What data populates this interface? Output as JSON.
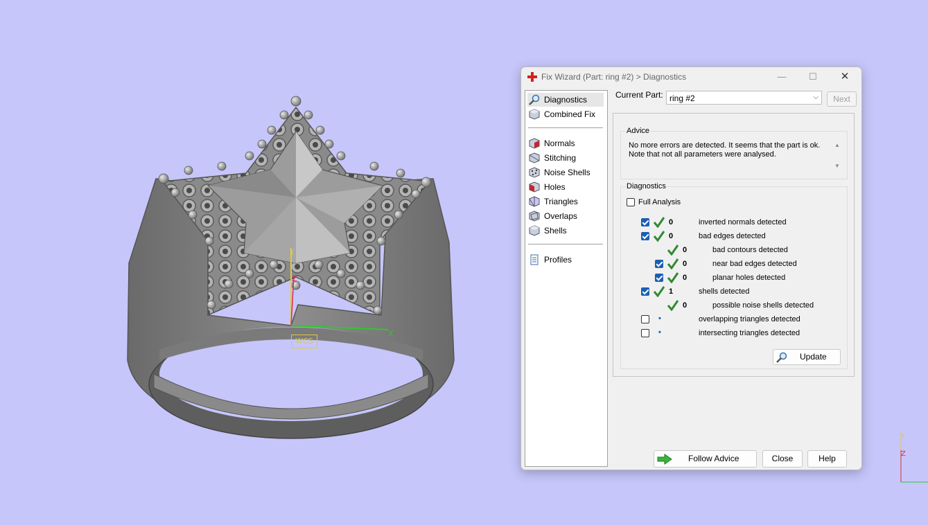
{
  "viewport": {
    "wcs_label": "WCS",
    "axis_x": "X",
    "axis_y": "Y",
    "axis_z": "Z"
  },
  "dialog": {
    "title": "Fix Wizard (Part: ring #2) > Diagnostics",
    "window_controls": {
      "minimize": "—",
      "maximize": "☐",
      "close": "✕"
    },
    "nav": {
      "items": [
        {
          "label": "Diagnostics",
          "icon": "magnifier-icon",
          "active": true
        },
        {
          "label": "Combined Fix",
          "icon": "cube-icon"
        },
        {
          "label": "Normals",
          "icon": "normals-icon"
        },
        {
          "label": "Stitching",
          "icon": "stitching-icon"
        },
        {
          "label": "Noise Shells",
          "icon": "noise-shells-icon"
        },
        {
          "label": "Holes",
          "icon": "holes-icon"
        },
        {
          "label": "Triangles",
          "icon": "triangles-icon"
        },
        {
          "label": "Overlaps",
          "icon": "overlaps-icon"
        },
        {
          "label": "Shells",
          "icon": "shells-icon"
        },
        {
          "label": "Profiles",
          "icon": "document-icon"
        }
      ]
    },
    "current_part": {
      "label": "Current Part:",
      "value": "ring #2"
    },
    "next_label": "Next",
    "advice": {
      "title": "Advice",
      "text": "No more errors are detected. It seems that the part is ok. Note that not all parameters were analysed."
    },
    "diagnostics": {
      "title": "Diagnostics",
      "full_analysis_label": "Full Analysis",
      "full_analysis_checked": false,
      "rows": [
        {
          "checked": true,
          "status": "ok",
          "count": "0",
          "label": "inverted normals detected"
        },
        {
          "checked": true,
          "status": "ok",
          "count": "0",
          "label": "bad edges detected"
        },
        {
          "checked": null,
          "status": "ok",
          "count": "0",
          "label": "bad contours detected"
        },
        {
          "checked": true,
          "status": "ok",
          "count": "0",
          "label": "near bad edges detected"
        },
        {
          "checked": true,
          "status": "ok",
          "count": "0",
          "label": "planar holes detected"
        },
        {
          "checked": true,
          "status": "ok",
          "count": "1",
          "label": "shells detected"
        },
        {
          "checked": null,
          "status": "ok",
          "count": "0",
          "label": "possible noise shells detected"
        },
        {
          "checked": false,
          "status": "not-run",
          "count": "",
          "label": "overlapping triangles detected"
        },
        {
          "checked": false,
          "status": "not-run",
          "count": "",
          "label": "intersecting triangles detected"
        }
      ],
      "update_label": "Update"
    },
    "buttons": {
      "follow_advice": "Follow Advice",
      "close": "Close",
      "help": "Help"
    }
  },
  "colors": {
    "background": "#c6c6fb",
    "check_green": "#2e8b2e",
    "checkbox_blue": "#1a5fb4",
    "wcs_yellow": "#e0c84a"
  }
}
